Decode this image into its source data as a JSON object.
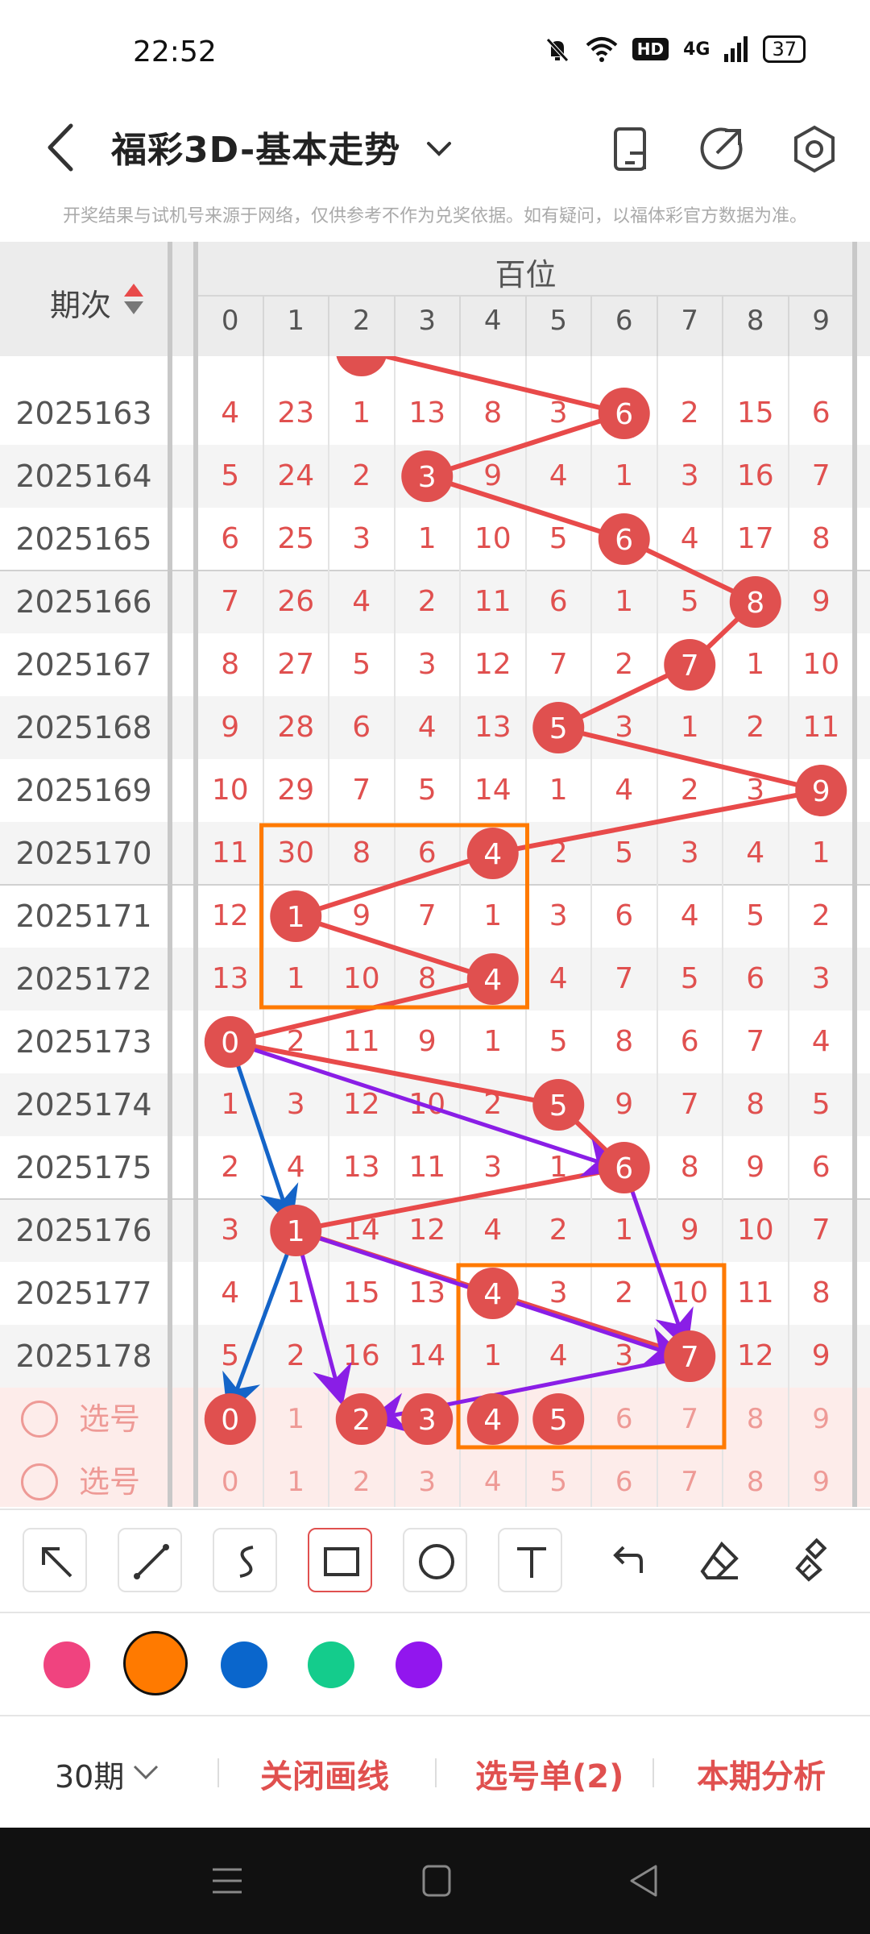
{
  "status_bar": {
    "time": "22:52",
    "hd": "HD",
    "network": "4G",
    "battery": "37"
  },
  "header": {
    "title": "福彩3D-基本走势"
  },
  "disclaimer": "开奖结果与试机号来源于网络，仅供参考不作为兑奖依据。如有疑问，以福体彩官方数据为准。",
  "table": {
    "period_header": "期次",
    "group_title": "百位",
    "digits": [
      "0",
      "1",
      "2",
      "3",
      "4",
      "5",
      "6",
      "7",
      "8",
      "9"
    ],
    "rows": [
      {
        "period": "2025163",
        "cells": [
          "4",
          "23",
          "1",
          "13",
          "8",
          "3",
          "6",
          "2",
          "15",
          "6"
        ],
        "hit": 6
      },
      {
        "period": "2025164",
        "cells": [
          "5",
          "24",
          "2",
          "3",
          "9",
          "4",
          "1",
          "3",
          "16",
          "7"
        ],
        "hit": 3
      },
      {
        "period": "2025165",
        "cells": [
          "6",
          "25",
          "3",
          "1",
          "10",
          "5",
          "6",
          "4",
          "17",
          "8"
        ],
        "hit": 6
      },
      {
        "period": "2025166",
        "cells": [
          "7",
          "26",
          "4",
          "2",
          "11",
          "6",
          "1",
          "5",
          "8",
          "9"
        ],
        "hit": 8
      },
      {
        "period": "2025167",
        "cells": [
          "8",
          "27",
          "5",
          "3",
          "12",
          "7",
          "2",
          "7",
          "1",
          "10"
        ],
        "hit": 7
      },
      {
        "period": "2025168",
        "cells": [
          "9",
          "28",
          "6",
          "4",
          "13",
          "5",
          "3",
          "1",
          "2",
          "11"
        ],
        "hit": 5
      },
      {
        "period": "2025169",
        "cells": [
          "10",
          "29",
          "7",
          "5",
          "14",
          "1",
          "4",
          "2",
          "3",
          "9"
        ],
        "hit": 9
      },
      {
        "period": "2025170",
        "cells": [
          "11",
          "30",
          "8",
          "6",
          "4",
          "2",
          "5",
          "3",
          "4",
          "1"
        ],
        "hit": 4
      },
      {
        "period": "2025171",
        "cells": [
          "12",
          "1",
          "9",
          "7",
          "1",
          "3",
          "6",
          "4",
          "5",
          "2"
        ],
        "hit": 1
      },
      {
        "period": "2025172",
        "cells": [
          "13",
          "1",
          "10",
          "8",
          "4",
          "4",
          "7",
          "5",
          "6",
          "3"
        ],
        "hit": 4
      },
      {
        "period": "2025173",
        "cells": [
          "0",
          "2",
          "11",
          "9",
          "1",
          "5",
          "8",
          "6",
          "7",
          "4"
        ],
        "hit": 0
      },
      {
        "period": "2025174",
        "cells": [
          "1",
          "3",
          "12",
          "10",
          "2",
          "5",
          "9",
          "7",
          "8",
          "5"
        ],
        "hit": 5
      },
      {
        "period": "2025175",
        "cells": [
          "2",
          "4",
          "13",
          "11",
          "3",
          "1",
          "6",
          "8",
          "9",
          "6"
        ],
        "hit": 6
      },
      {
        "period": "2025176",
        "cells": [
          "3",
          "1",
          "14",
          "12",
          "4",
          "2",
          "1",
          "9",
          "10",
          "7"
        ],
        "hit": 1
      },
      {
        "period": "2025177",
        "cells": [
          "4",
          "1",
          "15",
          "13",
          "4",
          "3",
          "2",
          "10",
          "11",
          "8"
        ],
        "hit": 4
      },
      {
        "period": "2025178",
        "cells": [
          "5",
          "2",
          "16",
          "14",
          "1",
          "4",
          "3",
          "7",
          "12",
          "9"
        ],
        "hit": 7
      }
    ],
    "select_rows": [
      {
        "label": "选号",
        "cells": [
          "0",
          "1",
          "2",
          "3",
          "4",
          "5",
          "6",
          "7",
          "8",
          "9"
        ],
        "picked": [
          0,
          2,
          3,
          4,
          5
        ]
      },
      {
        "label": "选号",
        "cells": [
          "0",
          "1",
          "2",
          "3",
          "4",
          "5",
          "6",
          "7",
          "8",
          "9"
        ],
        "picked": []
      }
    ]
  },
  "tools": [
    "arrow-tool",
    "line-tool",
    "curve-tool",
    "rectangle-tool",
    "circle-tool",
    "text-tool",
    "undo-tool",
    "eraser-tool",
    "clear-tool"
  ],
  "colors": [
    "#f0437f",
    "#ff7a00",
    "#0a66cc",
    "#14cc8c",
    "#9216ee"
  ],
  "selected_color": "#ff7a00",
  "colors_theme": {
    "accent": "#e0504f",
    "line": "#e84a4a",
    "box": "#ff7a00",
    "arrow_blue": "#1464c8",
    "arrow_purple": "#8a1ee6"
  },
  "bottom_bar": {
    "period": "30期",
    "close_drawing": "关闭画线",
    "selection_list": "选号单(2)",
    "analysis": "本期分析"
  }
}
